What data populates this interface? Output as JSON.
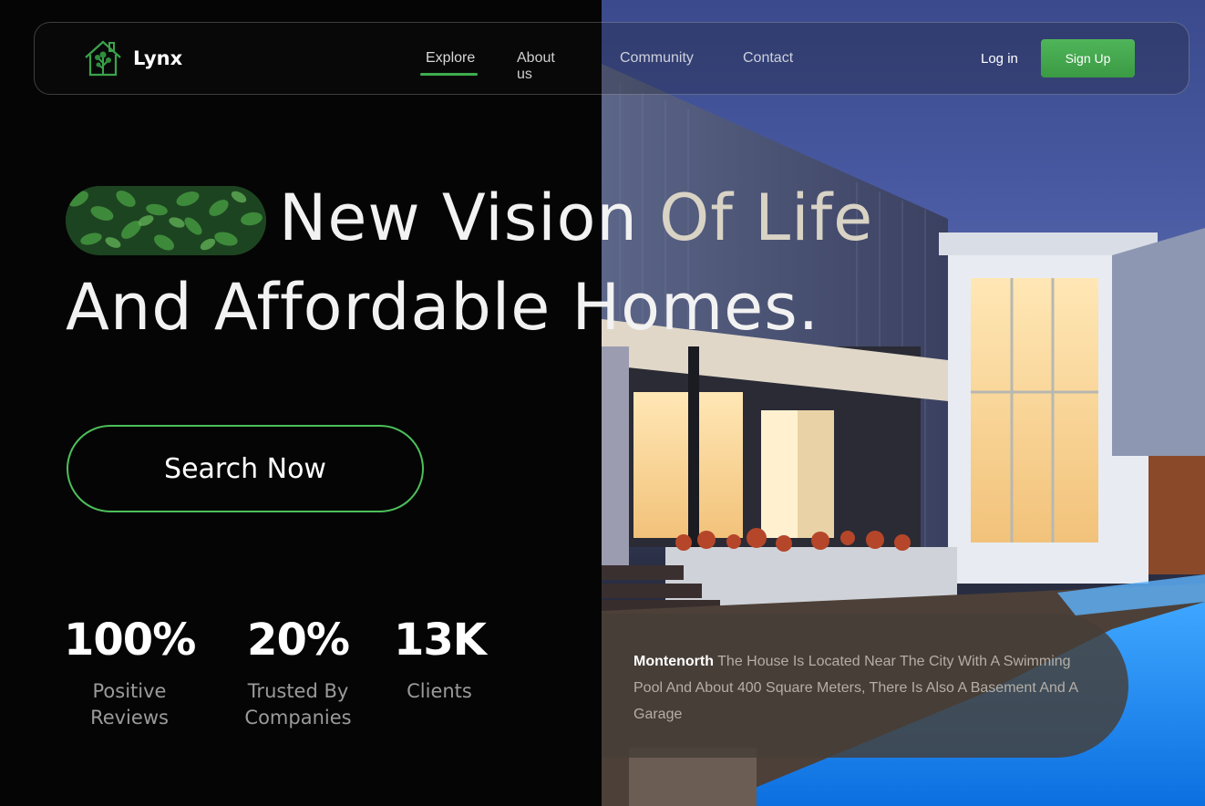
{
  "brand": {
    "name": "Lynx",
    "logo_icon": "house-tree-icon",
    "accent": "#3fae4c"
  },
  "nav": {
    "links": [
      {
        "label": "Explore",
        "active": true
      },
      {
        "label": "About us",
        "active": false
      },
      {
        "label": "Community",
        "active": false
      },
      {
        "label": "Contact",
        "active": false
      }
    ],
    "login_label": "Log in",
    "signup_label": "Sign Up"
  },
  "hero": {
    "headline_line1_bright": "New Vision ",
    "headline_line1_dim": "Of Life",
    "headline_line2": "And Affordable Homes.",
    "cta_label": "Search Now"
  },
  "stats": [
    {
      "value": "100%",
      "label_line1": "Positive",
      "label_line2": "Reviews"
    },
    {
      "value": "20%",
      "label_line1": "Trusted By",
      "label_line2": "Companies"
    },
    {
      "value": "13K",
      "label_line1": "Clients",
      "label_line2": ""
    }
  ],
  "property": {
    "name": "Montenorth",
    "description": " The House Is Located Near The City With A Swimming Pool And About 400 Square Meters, There Is Also A Basement And A Garage"
  }
}
